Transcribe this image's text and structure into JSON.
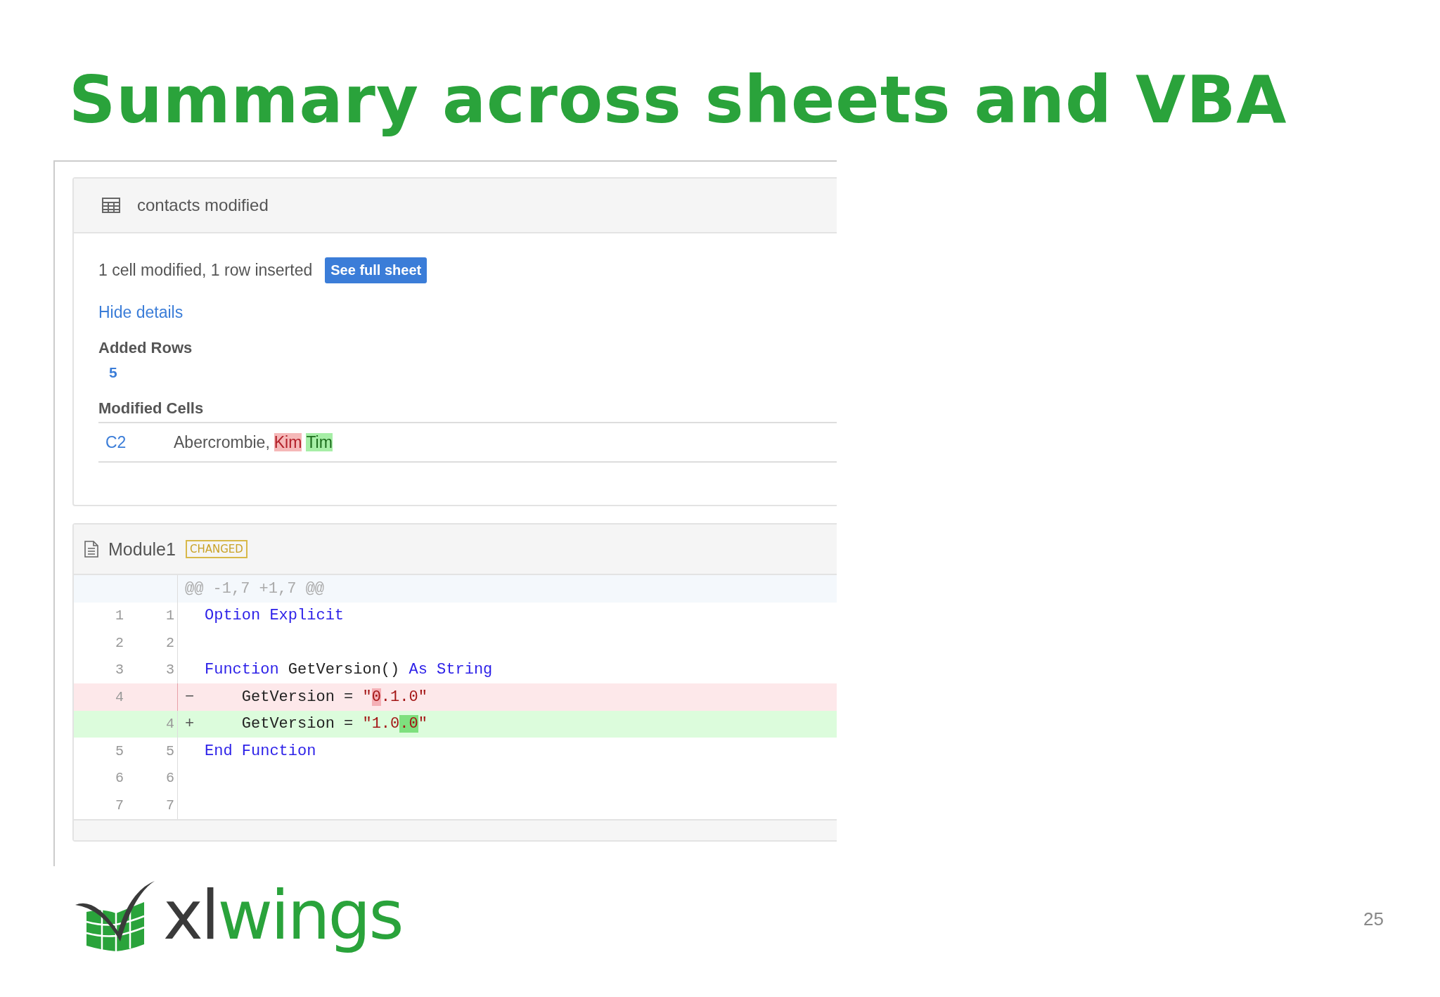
{
  "title": "Summary across sheets and VBA",
  "sheet_card": {
    "name": "contacts modified",
    "summary": "1 cell modified, 1 row inserted",
    "button": "See full sheet",
    "toggle_link": "Hide details",
    "added_rows": {
      "heading": "Added Rows",
      "rows": [
        "5"
      ]
    },
    "modified_cells": {
      "heading": "Modified Cells",
      "cells": [
        {
          "ref": "C2",
          "parts": [
            {
              "text": "Abercrombie,",
              "kind": "plain"
            },
            {
              "text": "Kim",
              "kind": "removed"
            },
            {
              "text": "Tim",
              "kind": "added"
            }
          ]
        }
      ]
    }
  },
  "module_card": {
    "name": "Module1",
    "badge": "CHANGED",
    "hunk": "@@ -1,7 +1,7 @@",
    "lines": [
      {
        "kind": "context",
        "old": "1",
        "new": "1",
        "tokens": [
          {
            "text": "Option Explicit",
            "kind": "keyword"
          }
        ]
      },
      {
        "kind": "context",
        "old": "2",
        "new": "2"
      },
      {
        "kind": "context",
        "old": "3",
        "new": "3",
        "tokens": [
          {
            "text": "Function",
            "kind": "keyword"
          },
          {
            "text": " GetVersion() ",
            "kind": "plain"
          },
          {
            "text": "As String",
            "kind": "keyword"
          }
        ]
      },
      {
        "kind": "deleted",
        "old": "4",
        "sign": "−",
        "tokens": [
          {
            "text": "    GetVersion = ",
            "kind": "plain"
          },
          {
            "text": "\"",
            "kind": "string"
          },
          {
            "text": "0",
            "kind": "removed"
          },
          {
            "text": ".1.0\"",
            "kind": "string"
          }
        ]
      },
      {
        "kind": "added",
        "new": "4",
        "sign": "+",
        "tokens": [
          {
            "text": "    GetVersion = ",
            "kind": "plain"
          },
          {
            "text": "\"1.0",
            "kind": "string"
          },
          {
            "text": ".0",
            "kind": "added"
          },
          {
            "text": "\"",
            "kind": "string"
          }
        ]
      },
      {
        "kind": "context",
        "old": "5",
        "new": "5",
        "tokens": [
          {
            "text": "End Function",
            "kind": "keyword"
          }
        ]
      },
      {
        "kind": "context",
        "old": "6",
        "new": "6"
      },
      {
        "kind": "context",
        "old": "7",
        "new": "7"
      }
    ]
  },
  "logo": {
    "dark": "xl",
    "green": "wings"
  },
  "page_number": "25"
}
